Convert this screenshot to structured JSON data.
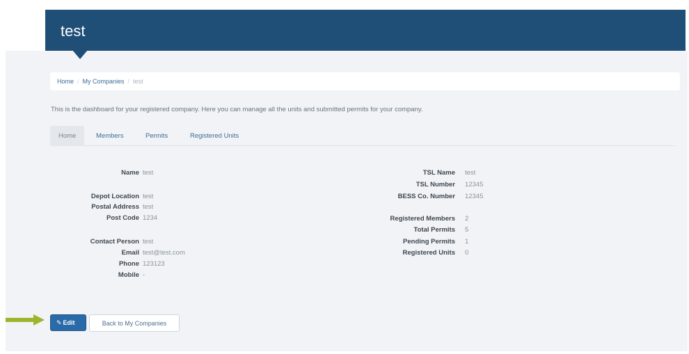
{
  "header": {
    "title": "test"
  },
  "breadcrumb": {
    "items": [
      "Home",
      "My Companies",
      "test"
    ]
  },
  "intro": "This is the dashboard for your registered company. Here you can manage all the units and submitted permits for your company.",
  "tabs": [
    {
      "label": "Home",
      "active": true
    },
    {
      "label": "Members"
    },
    {
      "label": "Permits"
    },
    {
      "label": "Registered Units"
    }
  ],
  "details_left": {
    "name": {
      "label": "Name",
      "value": "test"
    },
    "depot_location": {
      "label": "Depot Location",
      "value": "test"
    },
    "postal_address": {
      "label": "Postal Address",
      "value": "test"
    },
    "post_code": {
      "label": "Post Code",
      "value": "1234"
    },
    "contact_person": {
      "label": "Contact Person",
      "value": "test"
    },
    "email": {
      "label": "Email",
      "value": "test@test.com"
    },
    "phone": {
      "label": "Phone",
      "value": "123123"
    },
    "mobile": {
      "label": "Mobile",
      "value": "-"
    }
  },
  "details_right": {
    "tsl_name": {
      "label": "TSL Name",
      "value": "test"
    },
    "tsl_number": {
      "label": "TSL Number",
      "value": "12345"
    },
    "bess_number": {
      "label": "BESS Co. Number",
      "value": "12345"
    },
    "registered_members": {
      "label": "Registered Members",
      "value": "2"
    },
    "total_permits": {
      "label": "Total Permits",
      "value": "5"
    },
    "pending_permits": {
      "label": "Pending Permits",
      "value": "1"
    },
    "registered_units": {
      "label": "Registered Units",
      "value": "0"
    }
  },
  "actions": {
    "edit_label": "Edit",
    "back_label": "Back to My Companies"
  },
  "colors": {
    "header": "#1f4e77",
    "accent_button": "#2a6aa8",
    "arrow": "#9cb52c"
  },
  "icons": {
    "edit": "pencil-icon",
    "pointer": "arrow-right-icon"
  }
}
